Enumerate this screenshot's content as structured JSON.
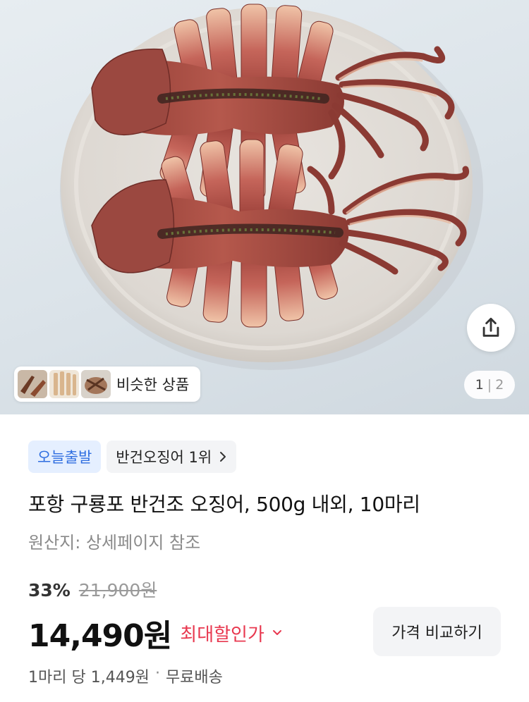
{
  "hero": {
    "image_icon": "grilled-squid-photo",
    "share_icon": "share-icon",
    "similar_products": {
      "label": "비슷한 상품",
      "thumbnail_count": 3
    },
    "page_indicator": {
      "current": "1",
      "separator": "|",
      "total": "2"
    }
  },
  "badges": {
    "today_shipping": "오늘출발",
    "rank": "반건오징어 1위",
    "rank_icon": "chevron-right-icon"
  },
  "product": {
    "title": "포항 구룡포 반건조 오징어, 500g 내외, 10마리",
    "origin": "원산지: 상세페이지 참조"
  },
  "pricing": {
    "discount_rate": "33%",
    "original_price": "21,900원",
    "price": "14,490원",
    "max_discount_label": "최대할인가",
    "max_discount_icon": "chevron-down-icon",
    "compare_button": "가격 비교하기",
    "unit_price": "1마리 당 1,449원",
    "separator": "·",
    "shipping": "무료배송"
  },
  "colors": {
    "accent_red": "#e8384f",
    "badge_blue": "#2f6ee0",
    "badge_blue_bg": "#e5efff"
  }
}
